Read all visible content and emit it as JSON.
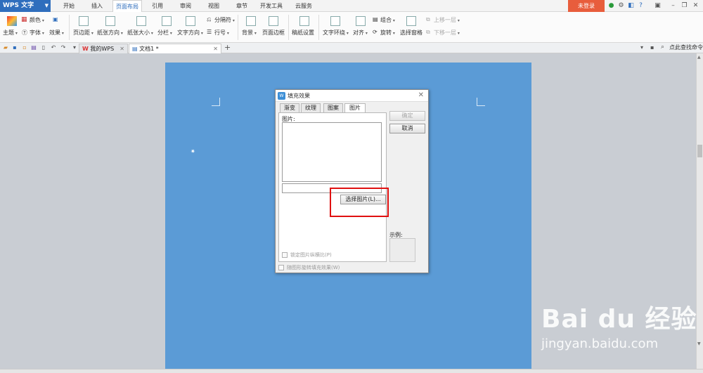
{
  "app": {
    "name": "WPS 文字",
    "login": "未登录"
  },
  "menu_tabs": [
    "开始",
    "插入",
    "页面布局",
    "引用",
    "审阅",
    "视图",
    "章节",
    "开发工具",
    "云服务"
  ],
  "active_menu": "页面布局",
  "ribbon": {
    "theme": "主题",
    "color": "颜色",
    "font": "字体",
    "effect": "效果",
    "margins": "页边距",
    "orientation": "纸张方向",
    "paper_size": "纸张大小",
    "columns": "分栏",
    "text_direction": "文字方向",
    "breaks": "分隔符",
    "line_numbers": "行号",
    "background": "背景",
    "page_border": "页面边框",
    "manuscript": "稿纸设置",
    "wrap_text": "文字环绕",
    "align": "对齐",
    "group": "组合",
    "rotate": "旋转",
    "selection_pane": "选择窗格",
    "bring_forward": "上移一层",
    "send_backward": "下移一层"
  },
  "tabs": [
    {
      "label": "我的WPS"
    },
    {
      "label": "文档1 *"
    }
  ],
  "search_command": "点此查找命令",
  "dialog": {
    "title": "填充效果",
    "tabs": [
      "渐变",
      "纹理",
      "图案",
      "图片"
    ],
    "active_tab": "图片",
    "picture_label": "图片:",
    "select_button": "选择图片(L)...",
    "lock_ratio": "锁定图片纵横比(P)",
    "rotate_fill": "随图形旋转填充效果(W)",
    "ok": "确定",
    "cancel": "取消",
    "sample_label": "示例:"
  },
  "watermark": {
    "brand": "Bai du 经验",
    "url": "jingyan.baidu.com"
  },
  "colors": {
    "accent": "#2f6ebd",
    "login": "#e85d3c",
    "page": "#5b9bd6",
    "highlight": "#e01010"
  }
}
